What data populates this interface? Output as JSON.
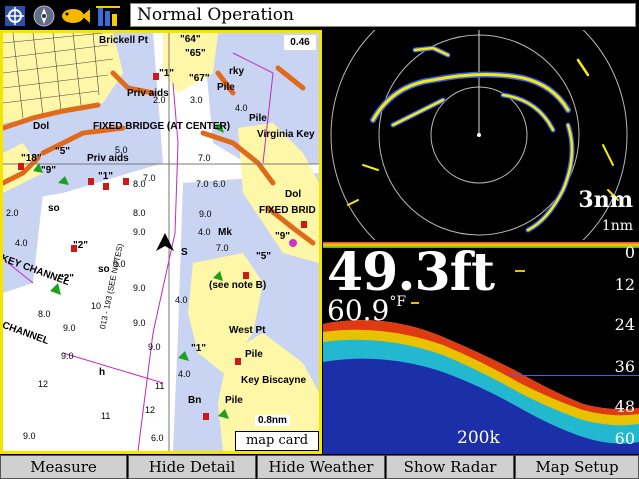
{
  "topbar": {
    "status_text": "Normal Operation",
    "icons": [
      "gps-icon",
      "compass-icon",
      "fish-icon",
      "battery-icon"
    ]
  },
  "map": {
    "zoom_label": "0.46",
    "scale_label": "0.8nm",
    "card_label": "map card",
    "labels": {
      "brickell": "Brickell Pt",
      "priv_aids_1": "Priv aids",
      "priv_aids_2": "Priv aids",
      "fixed_bridge_center": "FIXED BRIDGE (AT CENTER)",
      "virginia_key": "Virginia Key",
      "dol_1": "Dol",
      "dol_2": "Dol",
      "fixed_bridge_right": "FIXED BRID",
      "rky": "rky",
      "pile_1": "Pile",
      "pile_2": "Pile",
      "pile_3": "Pile",
      "pile_4": "Pile",
      "see_note": "(see note B)",
      "west_pt": "West Pt",
      "key_biscayne": "Key Biscayne",
      "key_channel": "KEY CHANNEL",
      "channel": "CHANNEL",
      "bn": "Bn",
      "mk": "Mk",
      "s": "S",
      "so1": "so",
      "so2": "so",
      "h": "h",
      "note": "013 - 193 (SEE NOTES)",
      "q64": "\"64\"",
      "q65": "\"65\"",
      "q67": "\"67\"",
      "q1a": "\"1\"",
      "q18": "\"18\"",
      "q5": "\"5\"",
      "q9": "\"9\"",
      "q1b": "\"1\"",
      "q2a": "\"2\"",
      "q2b": "\"2\"",
      "q5b": "\"5\"",
      "q1c": "\"1\"",
      "q9b": "\"9\""
    }
  },
  "radar": {
    "range_label": "3nm",
    "ring_label": "1nm"
  },
  "sonar": {
    "depth": "49.3ft",
    "temp": "60.9",
    "temp_unit": "°F",
    "frequency": "200k",
    "scale": [
      "0",
      "12",
      "24",
      "36",
      "48",
      "60"
    ]
  },
  "softkeys": [
    "Measure",
    "Hide Detail",
    "Hide Weather",
    "Show Radar",
    "Map Setup"
  ],
  "colors": {
    "map_border": "#f4e400",
    "land": "#fff7a8",
    "shallow": "#c9d4f2",
    "shore": "#e06a1a",
    "radar_echo": "#f4ec00",
    "radar_echo_edge": "#3a5cff"
  }
}
